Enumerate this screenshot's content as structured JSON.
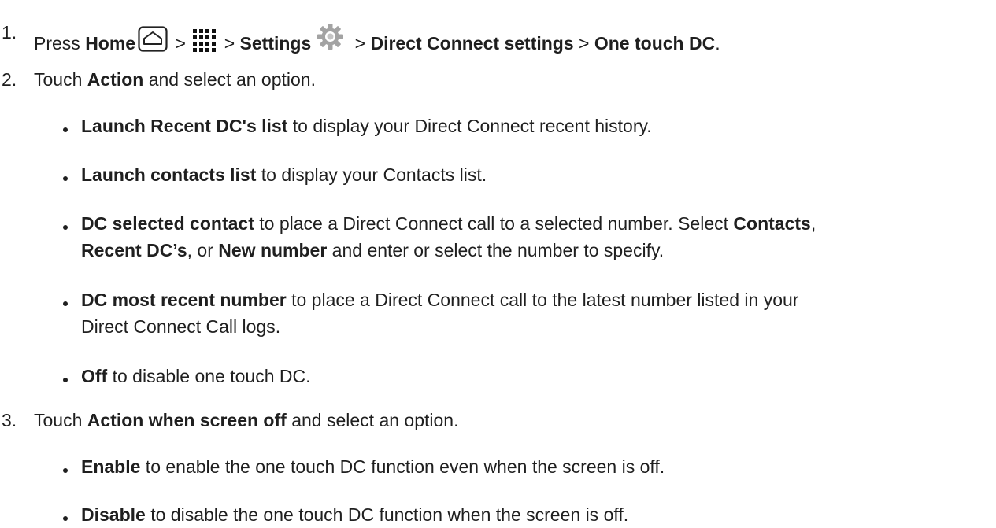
{
  "steps": [
    {
      "number": "1.",
      "segments": {
        "press": "Press ",
        "home": "Home",
        "sep1": " > ",
        "sep2": " > ",
        "settings": "Settings",
        "sep3": " > ",
        "direct_connect_settings": "Direct Connect settings",
        "sep4": " > ",
        "one_touch_dc": "One touch DC",
        "end": "."
      },
      "icons": [
        "home-icon",
        "apps-grid-icon",
        "settings-gear-icon"
      ]
    },
    {
      "number": "2.",
      "segments": {
        "touch": "Touch ",
        "action": "Action",
        "rest": " and select an option."
      },
      "options": [
        {
          "bold": "Launch Recent DC's list",
          "text": " to display your Direct Connect recent history."
        },
        {
          "bold": "Launch contacts list",
          "text": " to display your Contacts list."
        },
        {
          "bold": "DC selected contact",
          "text": " to place a Direct Connect call to a selected number. Select ",
          "b2": "Contacts",
          "t2": ",",
          "b3": "Recent DC’s",
          "t3": ", or ",
          "b4": "New number",
          "t4": " and enter or select the number to specify."
        },
        {
          "bold": "DC most recent number",
          "text": " to place a Direct Connect call to the latest number listed in your",
          "line2": "Direct Connect Call logs."
        },
        {
          "bold": "Off",
          "text": " to disable one touch DC."
        }
      ]
    },
    {
      "number": "3.",
      "segments": {
        "touch": "Touch ",
        "action": "Action when screen off",
        "rest": " and select an option."
      },
      "options": [
        {
          "bold": "Enable",
          "text": " to enable the one touch DC function even when the screen is off."
        },
        {
          "bold": "Disable",
          "text": " to disable the one touch DC function when the screen is off."
        }
      ]
    }
  ],
  "colors": {
    "text": "#1f1f1f",
    "icon_stroke": "#222222",
    "gear": "#9a9a9a"
  }
}
